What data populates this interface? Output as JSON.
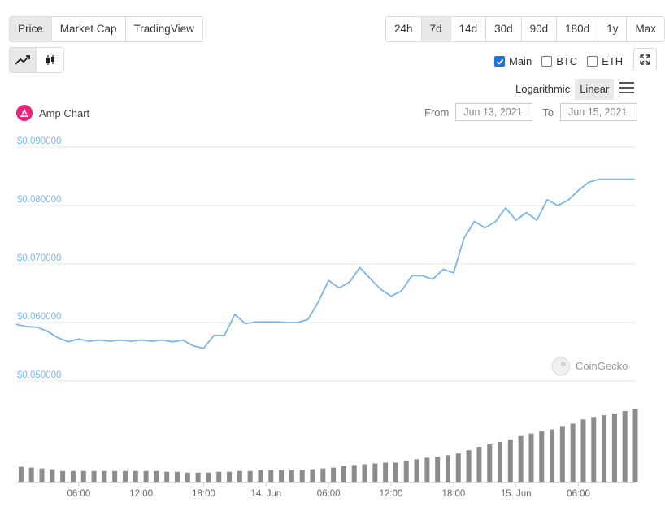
{
  "tabs": [
    {
      "label": "Price",
      "active": true
    },
    {
      "label": "Market Cap",
      "active": false
    },
    {
      "label": "TradingView",
      "active": false
    }
  ],
  "ranges": [
    {
      "label": "24h",
      "active": false
    },
    {
      "label": "7d",
      "active": true
    },
    {
      "label": "14d",
      "active": false
    },
    {
      "label": "30d",
      "active": false
    },
    {
      "label": "90d",
      "active": false
    },
    {
      "label": "180d",
      "active": false
    },
    {
      "label": "1y",
      "active": false
    },
    {
      "label": "Max",
      "active": false
    }
  ],
  "chart_types": [
    {
      "icon": "line-chart-icon",
      "active": true
    },
    {
      "icon": "candlestick-icon",
      "active": false
    }
  ],
  "checkboxes": [
    {
      "label": "Main",
      "checked": true
    },
    {
      "label": "BTC",
      "checked": false
    },
    {
      "label": "ETH",
      "checked": false
    }
  ],
  "scale": {
    "logarithmic": "Logarithmic",
    "linear": "Linear",
    "active": "Linear"
  },
  "coin": {
    "name": "Amp Chart",
    "color": "#e6267a"
  },
  "dates": {
    "from_label": "From",
    "from": "Jun 13, 2021",
    "to_label": "To",
    "to": "Jun 15, 2021"
  },
  "watermark": "CoinGecko",
  "colors": {
    "line": "#7cb5ec",
    "volume": "#8c8c8c",
    "axis_label": "#7cb5ec",
    "grid": "#e6e6e6"
  },
  "chart_data": {
    "type": "line",
    "price_axis": {
      "ticks": [
        0.05,
        0.06,
        0.07,
        0.08,
        0.09
      ],
      "tick_labels": [
        "$0.050000",
        "$0.060000",
        "$0.070000",
        "$0.080000",
        "$0.090000"
      ],
      "ylim": [
        0.05,
        0.09
      ]
    },
    "time_axis": {
      "range_hours": [
        0,
        59.5
      ],
      "ticks": [
        6,
        12,
        18,
        24,
        30,
        36,
        42,
        48,
        54
      ],
      "tick_labels": [
        "06:00",
        "12:00",
        "18:00",
        "14. Jun",
        "06:00",
        "12:00",
        "18:00",
        "15. Jun",
        "06:00"
      ]
    },
    "series": [
      {
        "type": "line",
        "x": [
          0,
          1,
          2,
          3,
          4,
          5,
          6,
          7,
          8,
          9,
          10,
          11,
          12,
          13,
          14,
          15,
          16,
          17,
          18,
          19,
          20,
          21,
          22,
          23,
          24,
          25,
          26,
          27,
          28,
          29,
          30,
          31,
          32,
          33,
          34,
          35,
          36,
          37,
          38,
          39,
          40,
          41,
          42,
          43,
          44,
          45,
          46,
          47,
          48,
          49,
          50,
          51,
          52,
          53,
          54,
          55,
          56,
          57,
          58,
          59,
          59.4
        ],
        "y": [
          0.0597,
          0.0593,
          0.0592,
          0.0585,
          0.0574,
          0.0567,
          0.0572,
          0.0568,
          0.057,
          0.0568,
          0.057,
          0.0568,
          0.057,
          0.0568,
          0.057,
          0.0567,
          0.057,
          0.056,
          0.0556,
          0.0578,
          0.0578,
          0.0614,
          0.0598,
          0.0601,
          0.0601,
          0.0601,
          0.06,
          0.06,
          0.0605,
          0.0635,
          0.0672,
          0.0659,
          0.0669,
          0.0694,
          0.0675,
          0.0657,
          0.0645,
          0.0654,
          0.068,
          0.068,
          0.0674,
          0.0691,
          0.0685,
          0.0744,
          0.0773,
          0.0762,
          0.0772,
          0.0796,
          0.0775,
          0.0788,
          0.0775,
          0.081,
          0.08,
          0.0809,
          0.0826,
          0.084,
          0.0845,
          0.0845,
          0.0845,
          0.0845,
          0.0845
        ]
      },
      {
        "type": "bar",
        "values": [
          18,
          17,
          16,
          15,
          13,
          13,
          13,
          13,
          13,
          13,
          13,
          13,
          13,
          13,
          12,
          12,
          11,
          11,
          11,
          12,
          12,
          13,
          13,
          14,
          14,
          14,
          14,
          14,
          15,
          16,
          17,
          19,
          20,
          21,
          22,
          23,
          23,
          25,
          27,
          29,
          30,
          32,
          34,
          38,
          42,
          45,
          48,
          51,
          55,
          58,
          61,
          63,
          67,
          70,
          75,
          78,
          80,
          82,
          85,
          88
        ]
      }
    ]
  }
}
